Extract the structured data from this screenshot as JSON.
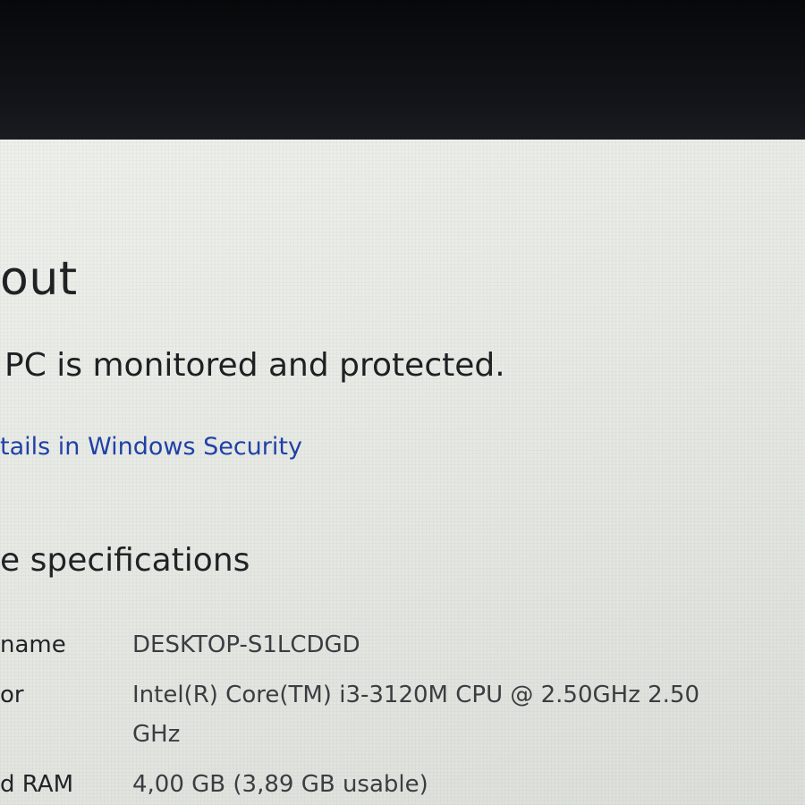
{
  "about": {
    "title": "out",
    "protection_status": "PC is monitored and protected.",
    "security_link": "tails in Windows Security"
  },
  "specs": {
    "heading": "e specifications",
    "rows": [
      {
        "label": "name",
        "value": "DESKTOP-S1LCDGD"
      },
      {
        "label": "or",
        "value": "Intel(R) Core(TM) i3-3120M CPU @ 2.50GHz   2.50",
        "value_cont": "GHz"
      },
      {
        "label": "d RAM",
        "value": "4,00 GB (3,89 GB usable)"
      }
    ]
  },
  "colors": {
    "link": "#1d3fa8",
    "text": "#1e1f22",
    "background": "#e9ebe6",
    "bezel": "#0c0e12"
  }
}
